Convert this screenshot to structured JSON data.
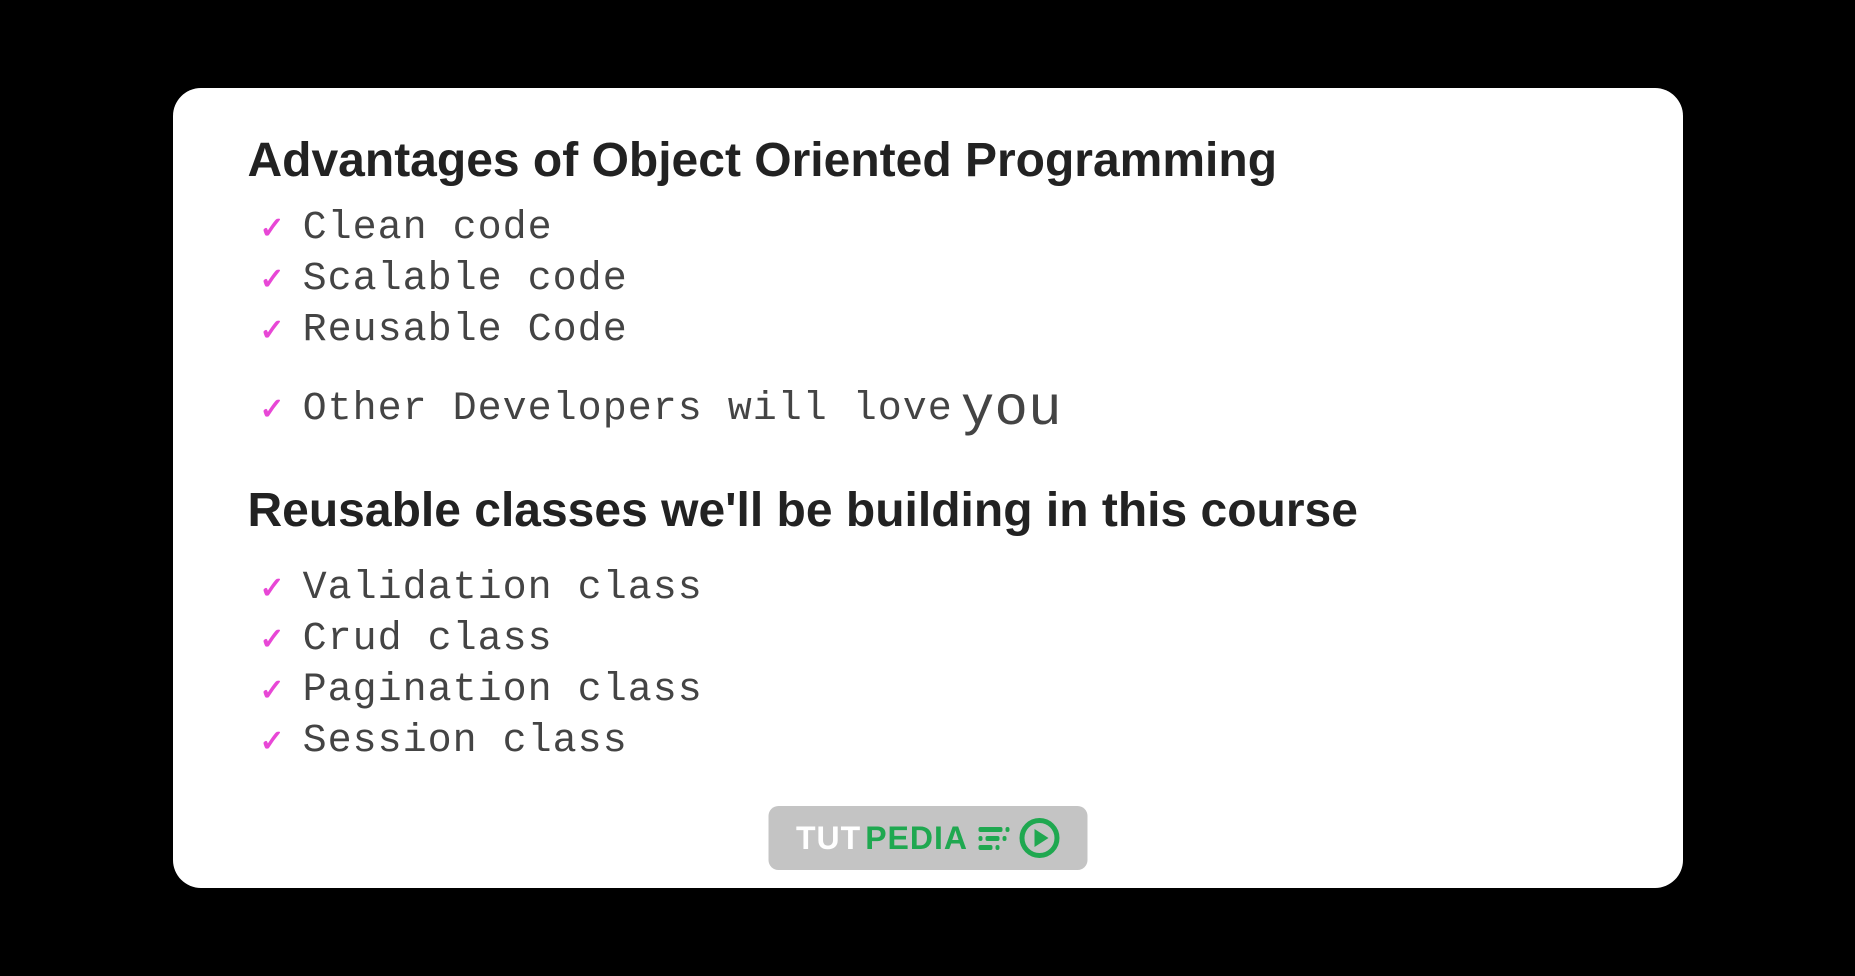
{
  "section1": {
    "heading": "Advantages of Object Oriented Programming",
    "items": [
      {
        "text": "Clean code",
        "emphasis": null
      },
      {
        "text": "Scalable code",
        "emphasis": null
      },
      {
        "text": "Reusable Code",
        "emphasis": null
      },
      {
        "text": "Other Developers will love",
        "emphasis": "you"
      }
    ]
  },
  "section2": {
    "heading": "Reusable classes we'll be building in this course",
    "items": [
      {
        "text": "Validation class"
      },
      {
        "text": "Crud class"
      },
      {
        "text": "Pagination class"
      },
      {
        "text": "Session class"
      }
    ]
  },
  "logo": {
    "part1": "TUT",
    "part2": "PEDIA"
  },
  "colors": {
    "checkmark": "#e847d6",
    "logoGreen": "#1fa850",
    "logoBg": "#c4c4c4"
  }
}
